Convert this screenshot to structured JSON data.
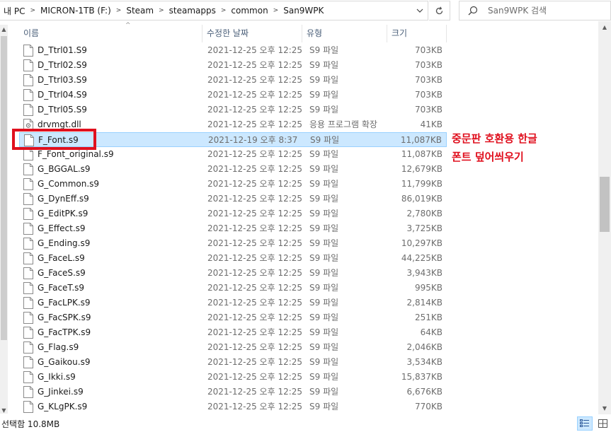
{
  "address": {
    "crumbs": [
      "내 PC",
      "MICRON-1TB (F:)",
      "Steam",
      "steamapps",
      "common",
      "San9WPK"
    ],
    "search_placeholder": "San9WPK 검색"
  },
  "columns": {
    "name": "이름",
    "date": "수정한 날짜",
    "type": "유형",
    "size": "크기"
  },
  "files": [
    {
      "name": "D_Ttrl01.S9",
      "date": "2021-12-25 오후 12:25",
      "type": "S9 파일",
      "size": "703KB",
      "icon": "file-icon"
    },
    {
      "name": "D_Ttrl02.S9",
      "date": "2021-12-25 오후 12:25",
      "type": "S9 파일",
      "size": "703KB",
      "icon": "file-icon"
    },
    {
      "name": "D_Ttrl03.S9",
      "date": "2021-12-25 오후 12:25",
      "type": "S9 파일",
      "size": "703KB",
      "icon": "file-icon"
    },
    {
      "name": "D_Ttrl04.S9",
      "date": "2021-12-25 오후 12:25",
      "type": "S9 파일",
      "size": "703KB",
      "icon": "file-icon"
    },
    {
      "name": "D_Ttrl05.S9",
      "date": "2021-12-25 오후 12:25",
      "type": "S9 파일",
      "size": "703KB",
      "icon": "file-icon"
    },
    {
      "name": "drvmgt.dll",
      "date": "2021-12-25 오후 12:25",
      "type": "응용 프로그램 확장",
      "size": "41KB",
      "icon": "dll-icon"
    },
    {
      "name": "F_Font.s9",
      "date": "2021-12-19 오후 8:37",
      "type": "S9 파일",
      "size": "11,087KB",
      "icon": "file-icon",
      "selected": true
    },
    {
      "name": "F_Font_original.s9",
      "date": "2021-12-25 오후 12:25",
      "type": "S9 파일",
      "size": "11,087KB",
      "icon": "file-icon"
    },
    {
      "name": "G_BGGAL.s9",
      "date": "2021-12-25 오후 12:25",
      "type": "S9 파일",
      "size": "12,679KB",
      "icon": "file-icon"
    },
    {
      "name": "G_Common.s9",
      "date": "2021-12-25 오후 12:25",
      "type": "S9 파일",
      "size": "11,799KB",
      "icon": "file-icon"
    },
    {
      "name": "G_DynEff.s9",
      "date": "2021-12-25 오후 12:25",
      "type": "S9 파일",
      "size": "86,019KB",
      "icon": "file-icon"
    },
    {
      "name": "G_EditPK.s9",
      "date": "2021-12-25 오후 12:25",
      "type": "S9 파일",
      "size": "2,780KB",
      "icon": "file-icon"
    },
    {
      "name": "G_Effect.s9",
      "date": "2021-12-25 오후 12:25",
      "type": "S9 파일",
      "size": "3,725KB",
      "icon": "file-icon"
    },
    {
      "name": "G_Ending.s9",
      "date": "2021-12-25 오후 12:25",
      "type": "S9 파일",
      "size": "10,297KB",
      "icon": "file-icon"
    },
    {
      "name": "G_FaceL.s9",
      "date": "2021-12-25 오후 12:25",
      "type": "S9 파일",
      "size": "44,225KB",
      "icon": "file-icon"
    },
    {
      "name": "G_FaceS.s9",
      "date": "2021-12-25 오후 12:25",
      "type": "S9 파일",
      "size": "3,943KB",
      "icon": "file-icon"
    },
    {
      "name": "G_FaceT.s9",
      "date": "2021-12-25 오후 12:25",
      "type": "S9 파일",
      "size": "995KB",
      "icon": "file-icon"
    },
    {
      "name": "G_FacLPK.s9",
      "date": "2021-12-25 오후 12:25",
      "type": "S9 파일",
      "size": "2,814KB",
      "icon": "file-icon"
    },
    {
      "name": "G_FacSPK.s9",
      "date": "2021-12-25 오후 12:25",
      "type": "S9 파일",
      "size": "251KB",
      "icon": "file-icon"
    },
    {
      "name": "G_FacTPK.s9",
      "date": "2021-12-25 오후 12:25",
      "type": "S9 파일",
      "size": "64KB",
      "icon": "file-icon"
    },
    {
      "name": "G_Flag.s9",
      "date": "2021-12-25 오후 12:25",
      "type": "S9 파일",
      "size": "2,046KB",
      "icon": "file-icon"
    },
    {
      "name": "G_Gaikou.s9",
      "date": "2021-12-25 오후 12:25",
      "type": "S9 파일",
      "size": "3,534KB",
      "icon": "file-icon"
    },
    {
      "name": "G_Ikki.s9",
      "date": "2021-12-25 오후 12:25",
      "type": "S9 파일",
      "size": "15,837KB",
      "icon": "file-icon"
    },
    {
      "name": "G_Jinkei.s9",
      "date": "2021-12-25 오후 12:25",
      "type": "S9 파일",
      "size": "6,676KB",
      "icon": "file-icon"
    },
    {
      "name": "G_KLgPK.s9",
      "date": "2021-12-25 오후 12:25",
      "type": "S9 파일",
      "size": "770KB",
      "icon": "file-icon"
    }
  ],
  "annotation": {
    "line1": "중문판 호환용 한글",
    "line2": "폰트 덮어씌우기",
    "color": "#e0101e"
  },
  "status": {
    "text": "선택함 10.8MB"
  },
  "colors": {
    "selection_bg": "#cce8ff",
    "selection_border": "#99d1ff",
    "header_text": "#4c607a"
  }
}
